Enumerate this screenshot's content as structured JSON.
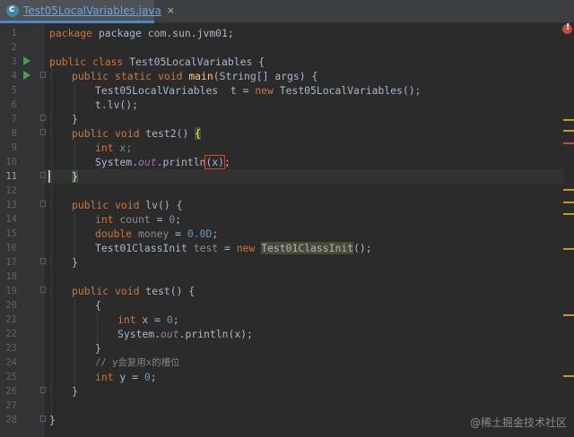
{
  "tab": {
    "filename": "Test05LocalVariables.java",
    "close": "×"
  },
  "line_numbers": [
    "1",
    "2",
    "3",
    "4",
    "5",
    "6",
    "7",
    "8",
    "9",
    "10",
    "11",
    "12",
    "13",
    "14",
    "15",
    "16",
    "17",
    "18",
    "19",
    "20",
    "21",
    "22",
    "23",
    "24",
    "25",
    "26",
    "27",
    "28"
  ],
  "code": {
    "l1": [
      "package com.sun.jvm01;"
    ],
    "l3": [
      "public class",
      " Test05LocalVariables {"
    ],
    "l4": [
      "public static void",
      " ",
      "main",
      "(String[] args) {"
    ],
    "l5": [
      "Test05LocalVariables  t = ",
      "new",
      " Test05LocalVariables();"
    ],
    "l6": [
      "t.lv();"
    ],
    "l7": [
      "}"
    ],
    "l8": [
      "public void",
      " test2() ",
      "{"
    ],
    "l9": [
      "int",
      " x;"
    ],
    "l10": [
      "System.",
      "out",
      ".println",
      "(x)",
      ";"
    ],
    "l11": [
      "}"
    ],
    "l13": [
      "public void",
      " lv() {"
    ],
    "l14": [
      "int",
      " ",
      "count",
      " = ",
      "0",
      ";"
    ],
    "l15": [
      "double",
      " ",
      "money",
      " = ",
      "0.0D",
      ";"
    ],
    "l16": [
      "Test01ClassInit ",
      "test",
      " = ",
      "new",
      " ",
      "Test01ClassInit",
      "();"
    ],
    "l17": [
      "}"
    ],
    "l19": [
      "public void",
      " test() {"
    ],
    "l20": [
      "{"
    ],
    "l21": [
      "int",
      " x = ",
      "0",
      ";"
    ],
    "l22": [
      "System.",
      "out",
      ".println(x);"
    ],
    "l23": [
      "}"
    ],
    "l24": [
      "// y会复用x的槽位"
    ],
    "l25": [
      "int",
      " y = ",
      "0",
      ";"
    ],
    "l26": [
      "}"
    ],
    "l28": [
      "}"
    ]
  },
  "watermark": "@稀土掘金技术社区",
  "colors": {
    "keyword": "#cc7832",
    "method": "#ffc66d",
    "number": "#6897bb",
    "field": "#9876aa",
    "text": "#a9b7c6",
    "comment": "#808080",
    "error": "#c7473a",
    "run": "#499c54"
  }
}
